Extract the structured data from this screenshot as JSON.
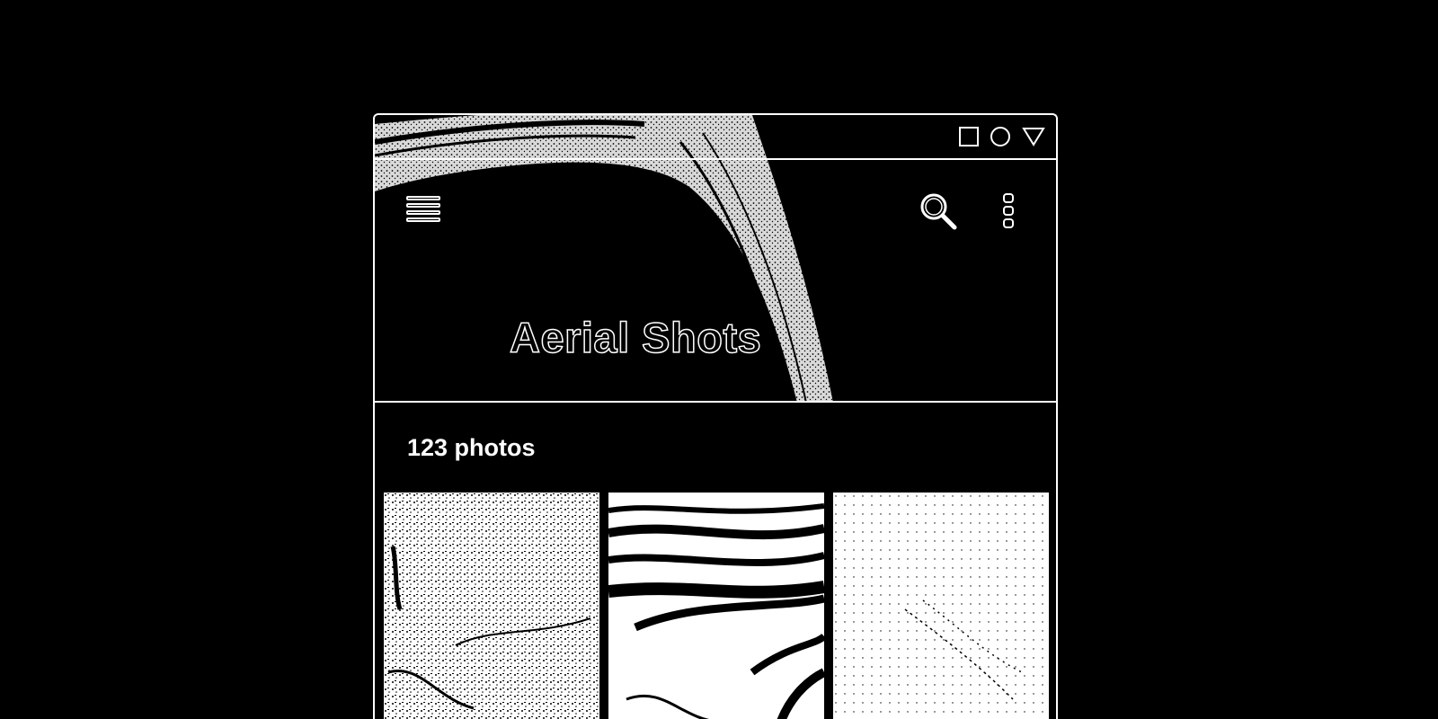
{
  "album": {
    "title": "Aerial Shots",
    "photo_count_label": "123 photos"
  },
  "toolbar": {
    "menu_icon": "hamburger-menu-icon",
    "search_icon": "search-icon",
    "more_icon": "more-vert-icon"
  },
  "system_nav": {
    "icons": [
      "square-recents-icon",
      "circle-home-icon",
      "triangle-back-icon"
    ]
  },
  "photos": [
    {
      "name": "photo-tile-1"
    },
    {
      "name": "photo-tile-2"
    },
    {
      "name": "photo-tile-3"
    }
  ],
  "colors": {
    "background": "#000000",
    "foreground": "#ffffff"
  }
}
